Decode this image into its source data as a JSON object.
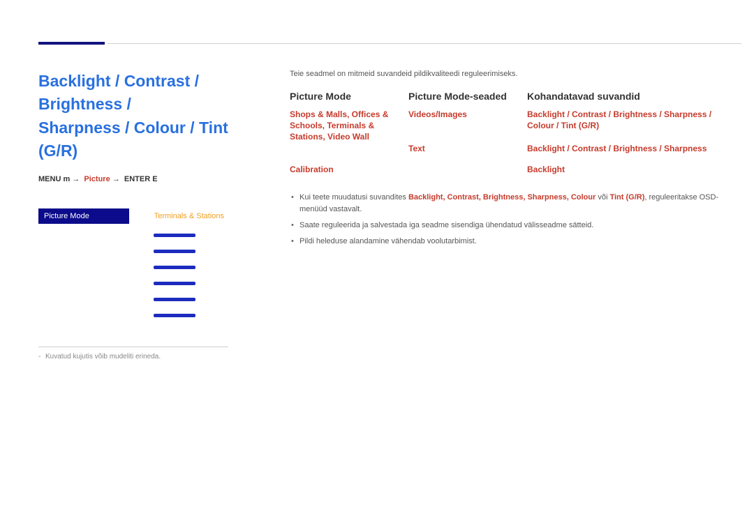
{
  "left": {
    "title_lines": [
      "Backlight / Contrast / Brightness /",
      "Sharpness / Colour / Tint (G/R)"
    ],
    "path_menu": "MENU",
    "path_m": "m",
    "path_picture": "Picture",
    "path_enter": "ENTER",
    "path_e": "E",
    "screenshot": {
      "header_left": "Picture Mode",
      "header_right": "Terminals & Stations"
    },
    "footnote": "Kuvatud kujutis võib mudeliti erineda."
  },
  "intro": "Teie seadmel on mitmeid suvandeid pildikvaliteedi reguleerimiseks.",
  "cols": {
    "a": "Picture Mode",
    "b": "Picture Mode-seaded",
    "c": "Kohandatavad suvandid"
  },
  "rows": {
    "r1": {
      "a": "Shops & Malls, Offices & Schools, Terminals & Stations, Video Wall",
      "b": "Videos/Images",
      "c": "Backlight / Contrast / Brightness / Sharpness / Colour / Tint (G/R)"
    },
    "r2": {
      "b": "Text",
      "c": "Backlight / Contrast / Brightness / Sharpness"
    },
    "r3": {
      "a": "Calibration",
      "c": "Backlight"
    }
  },
  "bullets": {
    "b1_pre": "Kui teete muudatusi suvandites ",
    "b1_mid": "Backlight, Contrast, Brightness, Sharpness, Colour",
    "b1_voi": " või ",
    "b1_tint": "Tint (G/R)",
    "b1_post": ", reguleeritakse OSD-menüüd vastavalt.",
    "b2": "Saate reguleerida ja salvestada iga seadme sisendiga ühendatud välisseadme sätteid.",
    "b3": "Pildi heleduse alandamine vähendab voolutarbimist."
  }
}
